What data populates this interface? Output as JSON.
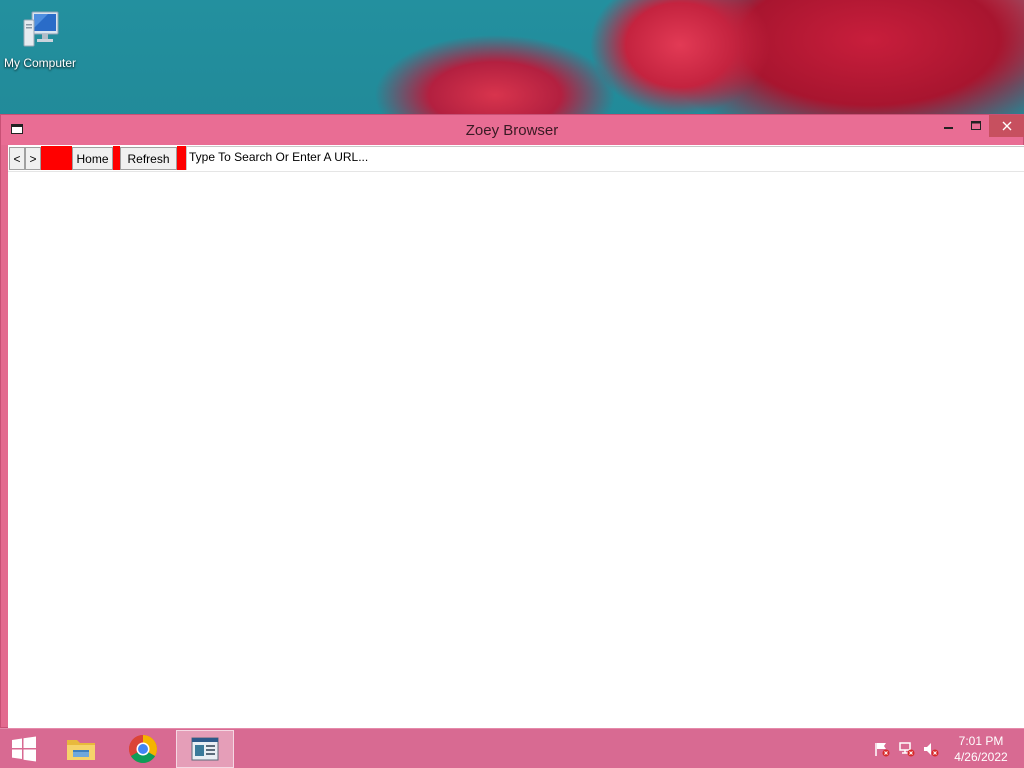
{
  "desktop": {
    "icons": [
      {
        "label": "My Computer",
        "icon": "computer-icon"
      }
    ]
  },
  "window": {
    "title": "Zoey Browser",
    "controls": {
      "minimize": "minimize-icon",
      "maximize": "maximize-icon",
      "close": "close-icon"
    }
  },
  "toolbar": {
    "back_label": "<",
    "forward_label": ">",
    "home_label": "Home",
    "refresh_label": "Refresh",
    "address_value": "",
    "address_placeholder": "Type To Search Or Enter A URL..."
  },
  "taskbar": {
    "apps": [
      {
        "name": "Start",
        "icon": "windows-start-icon"
      },
      {
        "name": "File Explorer",
        "icon": "file-explorer-icon"
      },
      {
        "name": "Google Chrome",
        "icon": "chrome-icon"
      },
      {
        "name": "Zoey Browser",
        "icon": "zoey-browser-icon",
        "active": true
      }
    ],
    "tray": [
      {
        "icon": "action-center-flag-icon"
      },
      {
        "icon": "network-icon"
      },
      {
        "icon": "volume-muted-icon"
      }
    ],
    "time": "7:01 PM",
    "date": "4/26/2022"
  },
  "colors": {
    "window_frame": "#e96d94",
    "taskbar": "#d86a92",
    "accent_red": "#ff0000",
    "close_button": "#c7505f"
  }
}
